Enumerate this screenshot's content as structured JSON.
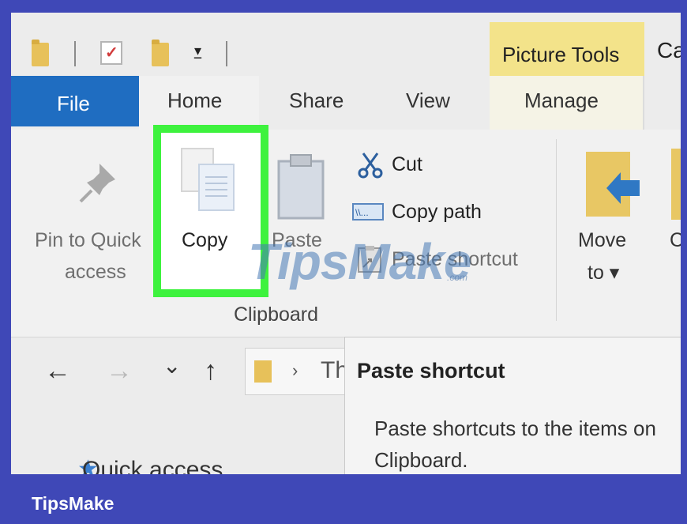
{
  "quick_access_toolbar": {
    "icons": [
      "folder-icon",
      "properties-icon",
      "new-folder-icon",
      "customize-dropdown-icon"
    ]
  },
  "contextual_tab_group": {
    "label": "Picture Tools"
  },
  "window_title_fragment": "Ca",
  "tabs": [
    {
      "label": "File"
    },
    {
      "label": "Home"
    },
    {
      "label": "Share"
    },
    {
      "label": "View"
    },
    {
      "label": "Manage"
    }
  ],
  "ribbon": {
    "pin_line1": "Pin to Quick",
    "pin_line2": "access",
    "copy": "Copy",
    "paste": "Paste",
    "cut": "Cut",
    "copy_path": "Copy path",
    "paste_shortcut": "Paste shortcut",
    "group_label": "Clipboard",
    "move_line1": "Move",
    "move_line2": "to",
    "next_fragment": "C"
  },
  "watermark": {
    "text": "TipsMake",
    "suffix": ".com"
  },
  "navigation": {
    "back": "←",
    "forward": "→",
    "recent": "⌄",
    "up": "↑",
    "address_fragment": "Th"
  },
  "sidebar": {
    "quick_access": "Quick access"
  },
  "tooltip": {
    "title": "Paste shortcut",
    "line1": "Paste shortcuts to the items on",
    "line2": "Clipboard."
  },
  "footer": {
    "brand": "TipsMake"
  },
  "colors": {
    "file_tab": "#1f6dc1",
    "picture_tools": "#f3e38a",
    "highlight": "#3ef23e",
    "frame": "#3f48b7"
  }
}
